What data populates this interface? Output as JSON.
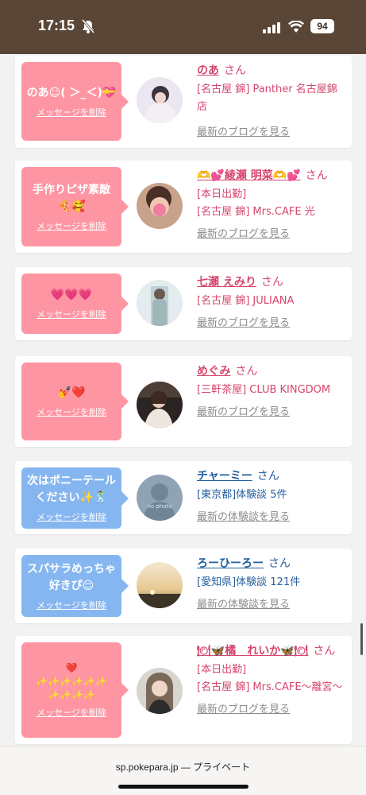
{
  "status_bar": {
    "time": "17:15",
    "battery": "94"
  },
  "cards": [
    {
      "message": "のあ☺︎( ＞_＜)💝",
      "delete_label": "メッセージを削除",
      "name": "のあ",
      "honorific": "さん",
      "detail": "[名古屋 錦] Panther 名古屋錦店",
      "link": "最新のブログを見る",
      "style": "pink"
    },
    {
      "message": "手作りピザ素敵🍕🥰",
      "delete_label": "メッセージを削除",
      "name": "🫶💕綾瀬 明菜🫶💕",
      "honorific": "さん",
      "detail": "[本日出勤]\n[名古屋 錦] Mrs.CAFE 光",
      "link": "最新のブログを見る",
      "style": "pink"
    },
    {
      "message": "💗💗💗",
      "delete_label": "メッセージを削除",
      "name": "七瀬 えみり",
      "honorific": "さん",
      "detail": "[名古屋 錦] JULIANA",
      "link": "最新のブログを見る",
      "style": "pink"
    },
    {
      "message": "💅❤️",
      "delete_label": "メッセージを削除",
      "name": "めぐみ",
      "honorific": "さん",
      "detail": "[三軒茶屋] CLUB KINGDOM",
      "link": "最新のブログを見る",
      "style": "pink"
    },
    {
      "message": "次はポニーテールください✨🕺",
      "delete_label": "メッセージを削除",
      "name": "チャーミー",
      "honorific": "さん",
      "detail": "[東京都]体験談 5件",
      "link": "最新の体験談を見る",
      "style": "blue",
      "avatar_text": "no photo"
    },
    {
      "message": "スパサラめっちゃ好きぴ😌",
      "delete_label": "メッセージを削除",
      "name": "ろーひーろー",
      "honorific": "さん",
      "detail": "[愛知県]体験談 121件",
      "link": "最新の体験談を見る",
      "style": "blue"
    },
    {
      "message": "❤️\n✨✨✨✨✨✨\n✨✨✨✨",
      "delete_label": "メッセージを削除",
      "name": "🍽🦋橘　れいか🦋🍽",
      "honorific": "さん",
      "detail": "[本日出勤]\n[名古屋 錦] Mrs.CAFE〜離宮〜",
      "link": "最新のブログを見る",
      "style": "pink"
    }
  ],
  "bottom_bar": {
    "url": "sp.pokepara.jp — プライベート"
  },
  "colors": {
    "pink_bubble": "#fe95a3",
    "blue_bubble": "#86b6f0",
    "pink_text": "#d6466d",
    "blue_text": "#25609f",
    "status_bar": "#5a4636"
  }
}
